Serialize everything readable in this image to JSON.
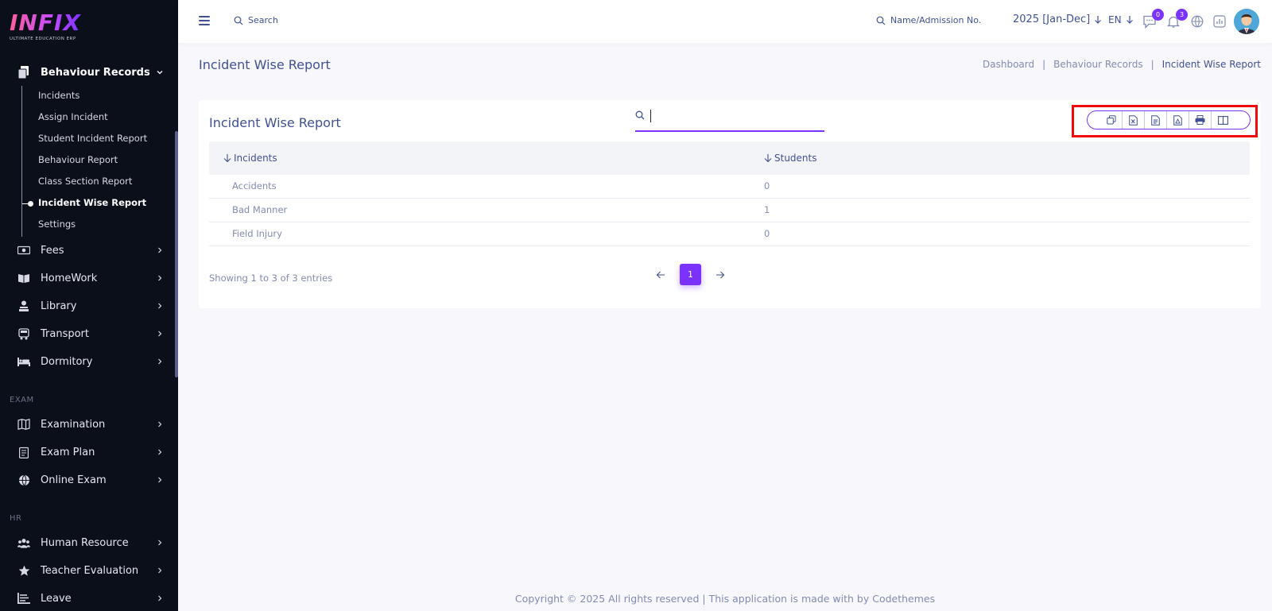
{
  "brand": {
    "name": "INFIX",
    "tagline": "ULTIMATE EDUCATION ERP"
  },
  "sidebar": {
    "active_group": {
      "label": "Behaviour Records",
      "icon": "document-stack-icon"
    },
    "sub_items": [
      {
        "label": "Incidents"
      },
      {
        "label": "Assign Incident"
      },
      {
        "label": "Student Incident Report"
      },
      {
        "label": "Behaviour Report"
      },
      {
        "label": "Class Section Report"
      },
      {
        "label": "Incident Wise Report",
        "active": true
      },
      {
        "label": "Settings"
      }
    ],
    "groups_top": [
      {
        "label": "Fees",
        "icon": "money-icon"
      },
      {
        "label": "HomeWork",
        "icon": "book-icon"
      },
      {
        "label": "Library",
        "icon": "library-icon"
      },
      {
        "label": "Transport",
        "icon": "bus-icon"
      },
      {
        "label": "Dormitory",
        "icon": "bed-icon"
      }
    ],
    "section_exam": "EXAM",
    "groups_exam": [
      {
        "label": "Examination",
        "icon": "map-icon"
      },
      {
        "label": "Exam Plan",
        "icon": "clipboard-icon"
      },
      {
        "label": "Online Exam",
        "icon": "globe-icon"
      }
    ],
    "section_hr": "HR",
    "groups_hr": [
      {
        "label": "Human Resource",
        "icon": "people-icon"
      },
      {
        "label": "Teacher Evaluation",
        "icon": "star-icon"
      },
      {
        "label": "Leave",
        "icon": "leave-icon"
      }
    ]
  },
  "topbar": {
    "search_label": "Search",
    "name_search_label": "Name/Admission No.",
    "year": "2025 [Jan-Dec]",
    "language": "EN",
    "chat_count": "0",
    "notification_count": "3"
  },
  "page": {
    "title": "Incident Wise Report",
    "breadcrumb": [
      "Dashboard",
      "Behaviour Records",
      "Incident Wise Report"
    ],
    "breadcrumb_sep": "|"
  },
  "card": {
    "title": "Incident Wise Report",
    "search_value": "",
    "export_buttons": [
      "copy-icon",
      "excel-icon",
      "csv-icon",
      "pdf-icon",
      "print-icon",
      "columns-icon"
    ],
    "columns": [
      "Incidents",
      "Students"
    ],
    "rows": [
      {
        "incident": "Accidents",
        "students": "0"
      },
      {
        "incident": "Bad Manner",
        "students": "1"
      },
      {
        "incident": "Field Injury",
        "students": "0"
      }
    ],
    "showing": "Showing 1 to 3 of 3 entries",
    "current_page": "1"
  },
  "footer": "Copyright © 2025 All rights reserved | This application is made with by Codethemes",
  "colors": {
    "accent": "#7c32ff",
    "text": "#415094",
    "muted": "#828bb2",
    "sidebar_bg": "#0b0f1a",
    "highlight": "#f00a0a"
  }
}
